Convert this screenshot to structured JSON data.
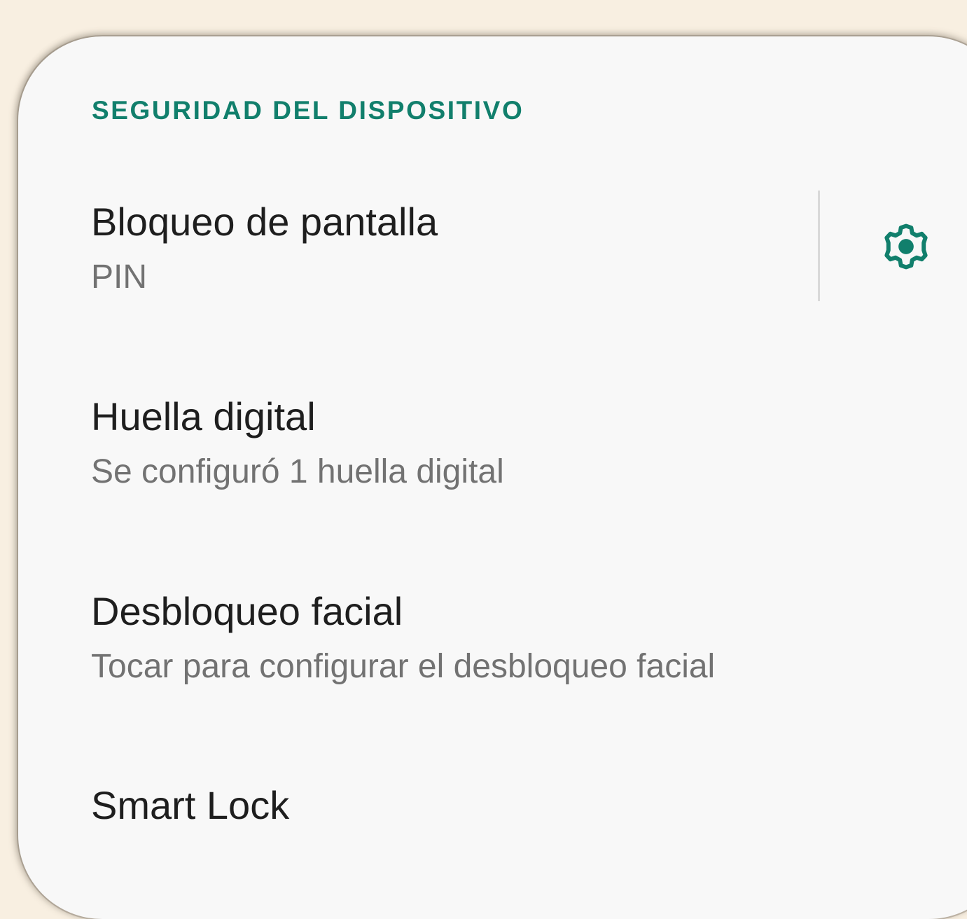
{
  "section": {
    "header": "SEGURIDAD DEL DISPOSITIVO"
  },
  "items": [
    {
      "title": "Bloqueo de pantalla",
      "summary": "PIN",
      "settings_icon": "gear-icon"
    },
    {
      "title": "Huella digital",
      "summary": "Se configuró 1 huella digital"
    },
    {
      "title": "Desbloqueo facial",
      "summary": "Tocar para configurar el desbloqueo facial"
    },
    {
      "title": "Smart Lock"
    }
  ],
  "colors": {
    "accent": "#117f6c",
    "title_text": "#1e1e1e",
    "summary_text": "#727272",
    "card_background": "#f8f8f8",
    "page_background": "#f8efe1"
  }
}
